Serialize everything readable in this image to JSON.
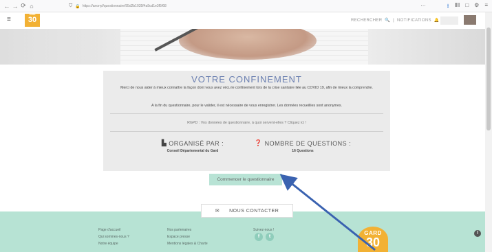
{
  "browser": {
    "nav": [
      "←",
      "→",
      "⟳",
      "⌂"
    ],
    "url": "https://anonyl/questionnaire/95d2b1035f4a9cd1e3f5f68",
    "ellipsis": "…",
    "right_icons": [
      "⭳",
      "ⅡⅡ",
      "□",
      "⚙",
      "≡"
    ]
  },
  "header": {
    "menu_icon": "≡",
    "logo_small": "GARD",
    "logo_text": "30",
    "search_label": "RECHERCHER",
    "separator": "|",
    "notifications_label": "NOTIFICATIONS"
  },
  "card": {
    "title": "VOTRE CONFINEMENT",
    "intro": "Merci de nous aider à mieux connaître la façon dont vous avez vécu le confinement lors de la crise sanitaire liée au COVID 19, afin de mieux la comprendre.",
    "note": "A la fin du questionnaire, pour le valider, il est nécessaire de vous enregistrer. Les données recueillies sont anonymes.",
    "rgpd": "RGPD : Vos données de questionnaire, à quoi servent-elles ? Cliquez ici !",
    "organise_label": "ORGANISÉ PAR :",
    "organise_value": "Conseil Départemental du Gard",
    "questions_label": "NOMBRE DE QUESTIONS :",
    "questions_value": "16 Questions"
  },
  "start_button": "Commencer le questionnaire",
  "contact": {
    "icon": "✉",
    "label": "NOUS CONTACTER"
  },
  "footer": {
    "col1": [
      "Page d'accueil",
      "Qui sommes-nous ?",
      "Notre équipe"
    ],
    "col2": [
      "Nos partenaires",
      "Espace presse",
      "Mentions légales & Charte"
    ],
    "col3_title": "Suivez-nous !",
    "social": [
      "f",
      "t"
    ],
    "gard_text": "GARD",
    "gard_number": "30",
    "help_icon": "!"
  },
  "colors": {
    "accent": "#b7e3d4",
    "brand": "#f2b134",
    "title": "#6a7fb0",
    "arrow": "#3a62b0"
  }
}
